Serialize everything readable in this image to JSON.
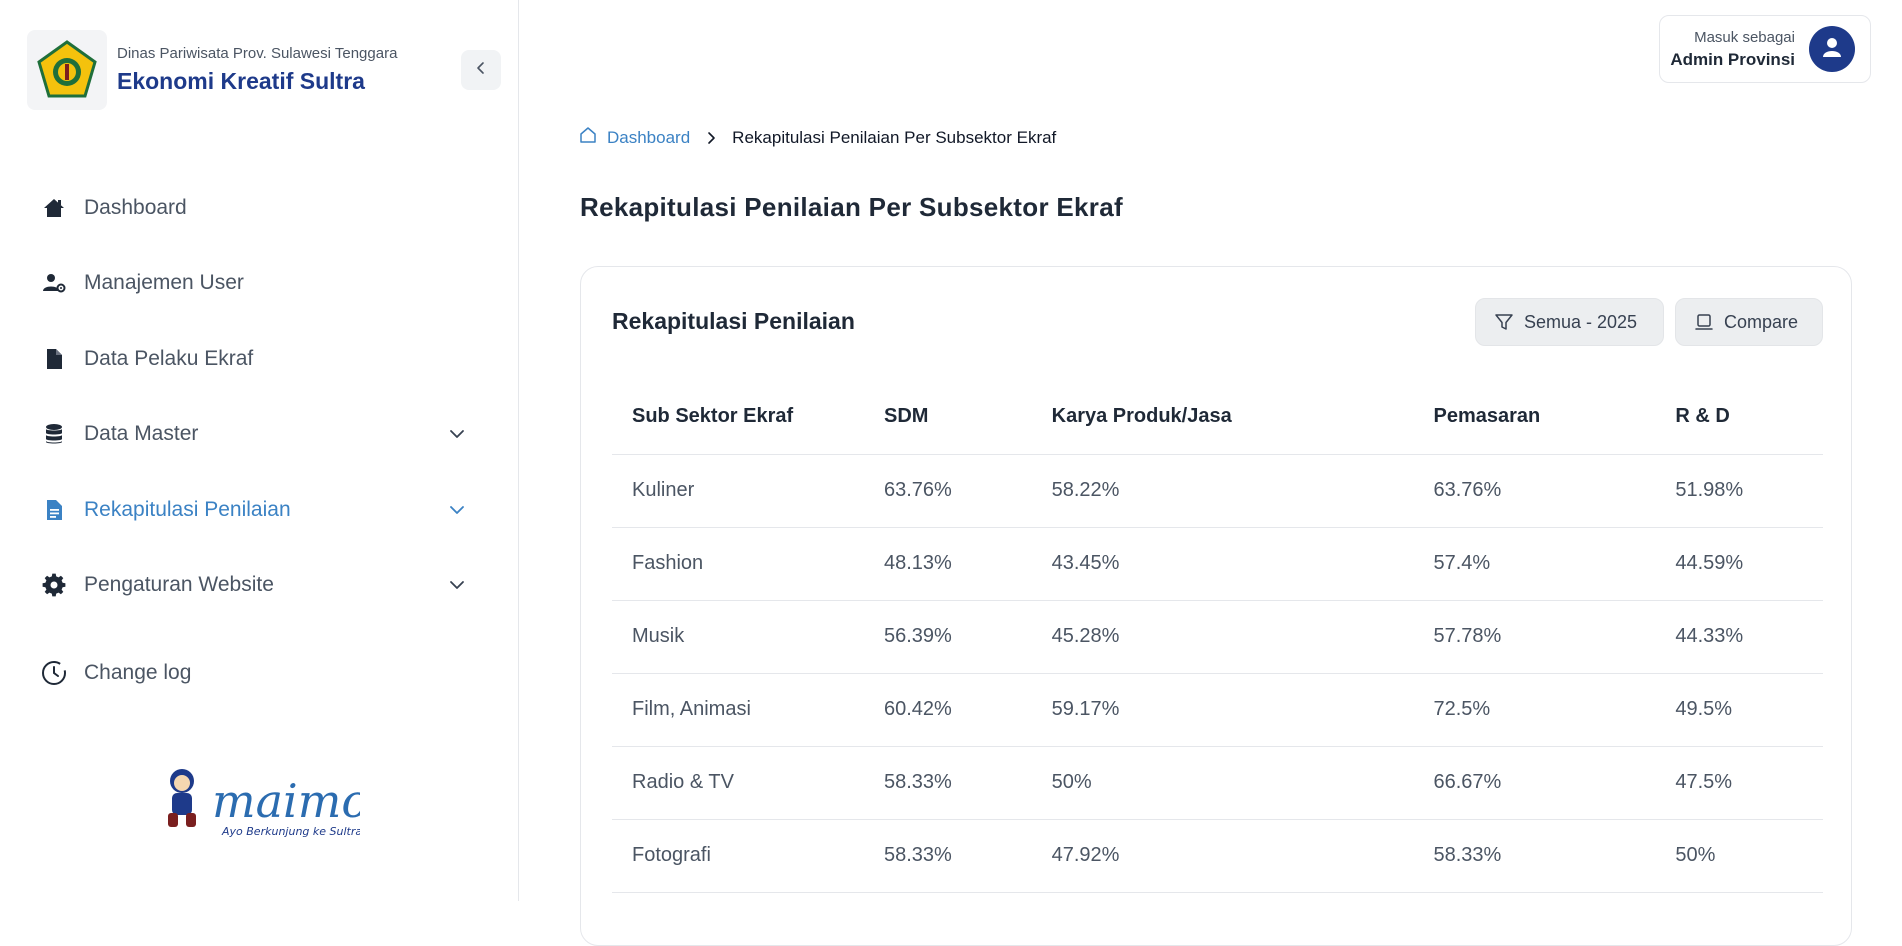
{
  "brand": {
    "subtitle": "Dinas Pariwisata Prov. Sulawesi Tenggara",
    "title": "Ekonomi Kreatif Sultra"
  },
  "sidebar": {
    "items": [
      {
        "label": "Dashboard",
        "icon": "home-icon"
      },
      {
        "label": "Manajemen User",
        "icon": "user-gear-icon"
      },
      {
        "label": "Data Pelaku Ekraf",
        "icon": "document-icon"
      },
      {
        "label": "Data Master",
        "icon": "database-icon",
        "expandable": true
      },
      {
        "label": "Rekapitulasi Penilaian",
        "icon": "file-text-icon",
        "expandable": true,
        "active": true
      },
      {
        "label": "Pengaturan Website",
        "icon": "gear-icon",
        "expandable": true
      }
    ],
    "changelog": "Change log",
    "mascot": {
      "wordmark": "maimo",
      "tagline": "Ayo Berkunjung ke Sultra"
    }
  },
  "user": {
    "caption": "Masuk sebagai",
    "name": "Admin Provinsi"
  },
  "breadcrumb": {
    "home": "Dashboard",
    "current": "Rekapitulasi Penilaian Per Subsektor Ekraf"
  },
  "page_title": "Rekapitulasi Penilaian Per Subsektor Ekraf",
  "card": {
    "title": "Rekapitulasi Penilaian",
    "filter_label": "Semua - 2025",
    "compare_label": "Compare"
  },
  "table": {
    "headers": [
      "Sub Sektor Ekraf",
      "SDM",
      "Karya Produk/Jasa",
      "Pemasaran",
      "R & D"
    ],
    "rows": [
      [
        "Kuliner",
        "63.76%",
        "58.22%",
        "63.76%",
        "51.98%"
      ],
      [
        "Fashion",
        "48.13%",
        "43.45%",
        "57.4%",
        "44.59%"
      ],
      [
        "Musik",
        "56.39%",
        "45.28%",
        "57.78%",
        "44.33%"
      ],
      [
        "Film, Animasi",
        "60.42%",
        "59.17%",
        "72.5%",
        "49.5%"
      ],
      [
        "Radio & TV",
        "58.33%",
        "50%",
        "66.67%",
        "47.5%"
      ],
      [
        "Fotografi",
        "58.33%",
        "47.92%",
        "58.33%",
        "50%"
      ]
    ]
  },
  "colors": {
    "accent": "#3b82c4",
    "brand": "#1e3a8a"
  }
}
